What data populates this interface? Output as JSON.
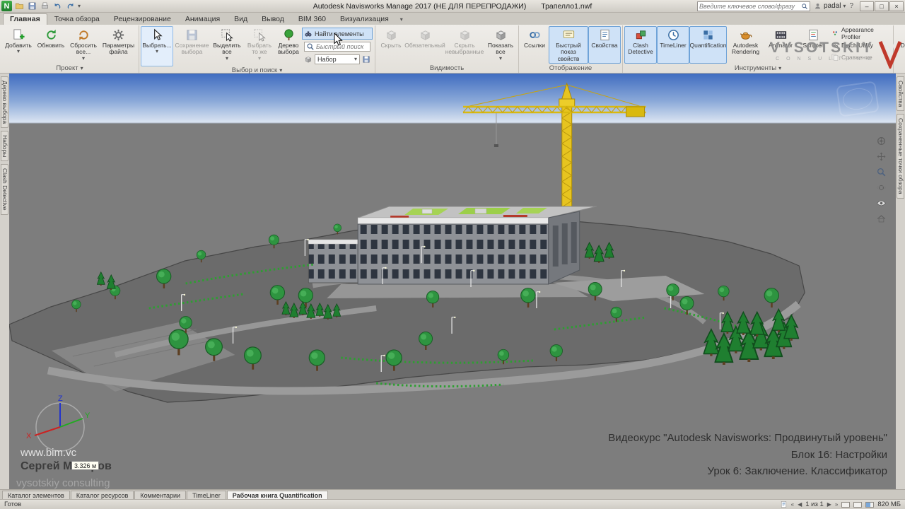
{
  "title_bar": {
    "logo": "N",
    "app_title": "Autodesk Navisworks Manage 2017 (НЕ ДЛЯ ПЕРЕПРОДАЖИ)",
    "doc_title": "Трапелло1.nwf",
    "search_placeholder": "Введите ключевое слово/фразу",
    "user": "padal"
  },
  "icons": {
    "dropdown": "▾",
    "minimize": "–",
    "maximize": "□",
    "close": "×",
    "help": "?",
    "first": "«",
    "prev": "◀",
    "next": "▶",
    "last": "»"
  },
  "ribbon_tabs": [
    {
      "label": "Главная"
    },
    {
      "label": "Точка обзора"
    },
    {
      "label": "Рецензирование"
    },
    {
      "label": "Анимация"
    },
    {
      "label": "Вид"
    },
    {
      "label": "Вывод"
    },
    {
      "label": "BIM 360"
    },
    {
      "label": "Визуализация"
    }
  ],
  "ribbon": {
    "groups": [
      {
        "label": "Проект",
        "buttons": [
          {
            "label": "Добавить"
          },
          {
            "label": "Обновить"
          },
          {
            "label": "Сбросить все..."
          },
          {
            "label": "Параметры файла"
          }
        ]
      },
      {
        "label": "Выбор и поиск",
        "buttons": [
          {
            "label": "Выбрать..."
          },
          {
            "label": "Сохранение выбора"
          },
          {
            "label": "Выделить все"
          },
          {
            "label": "Выбрать то же"
          },
          {
            "label": "Дерево выбора"
          }
        ],
        "find_items": "Найти элементы",
        "quick_search": "Быстрый поиск",
        "set_label": "Набор"
      },
      {
        "label": "Видимость",
        "buttons": [
          {
            "label": "Скрыть"
          },
          {
            "label": "Обязательный"
          },
          {
            "label": "Скрыть невыбранные"
          },
          {
            "label": "Показать все"
          }
        ]
      },
      {
        "label": "Отображение",
        "buttons": [
          {
            "label": "Ссылки"
          },
          {
            "label": "Быстрый показ свойств"
          },
          {
            "label": "Свойства"
          }
        ]
      },
      {
        "label": "Инструменты",
        "buttons": [
          {
            "label": "Clash Detective"
          },
          {
            "label": "TimeLiner"
          },
          {
            "label": "Quantification"
          },
          {
            "label": "Autodesk Rendering"
          },
          {
            "label": "Animator"
          },
          {
            "label": "Scripter"
          }
        ],
        "small": [
          {
            "label": "Appearance Profiler"
          },
          {
            "label": "Batch Utility"
          },
          {
            "label": "Сравнение"
          }
        ]
      },
      {
        "label": "",
        "buttons": [
          {
            "label": "DataTools"
          }
        ]
      }
    ]
  },
  "dock": {
    "left_tabs": [
      "Дерево выбора",
      "Наборы",
      "Clash Detective"
    ],
    "right_tabs": [
      "Свойства",
      "Сохраненные точки обзора"
    ]
  },
  "viewport": {
    "axes": {
      "x": "X",
      "y": "Y",
      "z": "Z"
    },
    "measurement": "3.326 м",
    "watermark_site": "www.bim.vc",
    "watermark_author": "Сергей Макаров",
    "watermark_company": "vysotskiy consulting",
    "course_line1": "Видеокурс \"Autodesk Navisworks: Продвинутый уровень\"",
    "course_line2": "Блок 16: Настройки",
    "course_line3": "Урок 6: Заключение. Классификатор"
  },
  "branding": {
    "name": "VYSOTSKIY",
    "sub": "C O N S U L T I N G"
  },
  "bottom_tabs": [
    {
      "label": "Каталог элементов"
    },
    {
      "label": "Каталог ресурсов"
    },
    {
      "label": "Комментарии"
    },
    {
      "label": "TimeLiner"
    },
    {
      "label": "Рабочая книга Quantification"
    }
  ],
  "status_bar": {
    "ready": "Готов",
    "page": "1 из 1",
    "memory": "820 МБ"
  }
}
